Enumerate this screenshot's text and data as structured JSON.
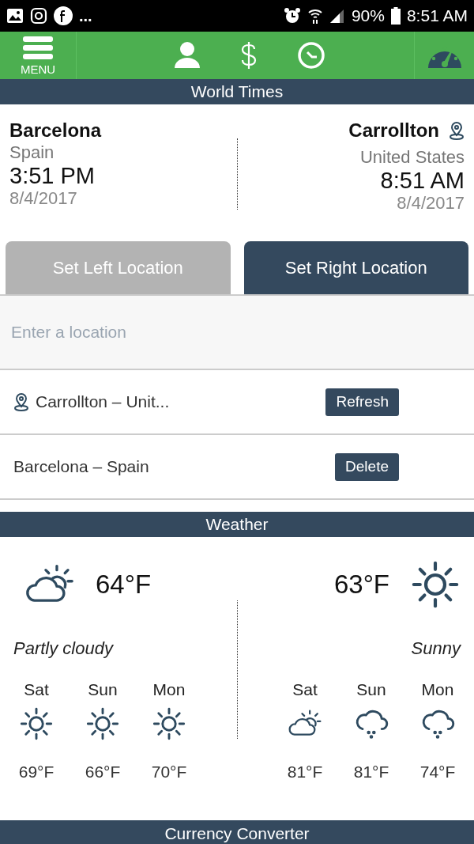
{
  "status_bar": {
    "more": "...",
    "battery": "90%",
    "time": "8:51 AM"
  },
  "nav": {
    "menu_label": "MENU"
  },
  "world_times": {
    "title": "World Times",
    "left": {
      "city": "Barcelona",
      "country": "Spain",
      "time": "3:51 PM",
      "date": "8/4/2017",
      "current_location": false
    },
    "right": {
      "city": "Carrollton",
      "country": "United States",
      "time": "8:51 AM",
      "date": "8/4/2017",
      "current_location": true
    }
  },
  "tabs": [
    {
      "label": "Set Left Location",
      "selected": false
    },
    {
      "label": "Set Right Location",
      "selected": true
    }
  ],
  "search": {
    "placeholder": "Enter a location"
  },
  "locations": [
    {
      "name": "Carrollton – Unit...",
      "current_location": true,
      "button": "Refresh"
    },
    {
      "name": "Barcelona – Spain",
      "current_location": false,
      "button": "Delete"
    }
  ],
  "weather": {
    "title": "Weather",
    "left": {
      "kind": "partly-cloudy",
      "temp": "64°F",
      "condition": "Partly cloudy",
      "forecast": [
        {
          "day": "Sat",
          "kind": "sunny",
          "temp": "69°F"
        },
        {
          "day": "Sun",
          "kind": "sunny",
          "temp": "66°F"
        },
        {
          "day": "Mon",
          "kind": "sunny",
          "temp": "70°F"
        }
      ]
    },
    "right": {
      "kind": "sunny",
      "temp": "63°F",
      "condition": "Sunny",
      "forecast": [
        {
          "day": "Sat",
          "kind": "partly-cloudy",
          "temp": "81°F"
        },
        {
          "day": "Sun",
          "kind": "rain",
          "temp": "81°F"
        },
        {
          "day": "Mon",
          "kind": "rain",
          "temp": "74°F"
        }
      ]
    }
  },
  "currency": {
    "title": "Currency Converter"
  }
}
